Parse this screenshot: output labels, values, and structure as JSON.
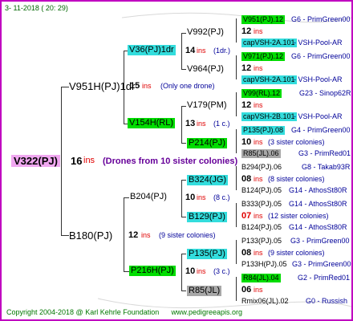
{
  "header": {
    "date": "3- 11-2018 ( 20: 29)"
  },
  "root": {
    "name": "V322(PJ)",
    "ins_count": "16",
    "ins_label": "ins",
    "note": "(Drones from 10 sister colonies)"
  },
  "gen1": [
    {
      "name": "V951H(PJ)1dr",
      "ins_count": "15",
      "ins_label": "ins",
      "note": "(Only one drone)"
    },
    {
      "name": "B180(PJ)",
      "ins_count": "12",
      "ins_label": "ins",
      "note": "(9 sister colonies)"
    }
  ],
  "gen2": [
    {
      "name": "V36(PJ)1dr",
      "ins_count": "14",
      "ins_label": "ins",
      "note": "(1dr.)"
    },
    {
      "name": "V154H(RL)",
      "ins_count": "13",
      "ins_label": "ins",
      "note": "(1 c.)"
    },
    {
      "name": "B204(PJ)",
      "ins_count": "10",
      "ins_label": "ins",
      "note": "(8 c.)"
    },
    {
      "name": "P216H(PJ)",
      "ins_count": "10",
      "ins_label": "ins",
      "note": "(3 c.)"
    }
  ],
  "gen3": [
    {
      "name": "V992(PJ)"
    },
    {
      "name": "V964(PJ)"
    },
    {
      "name": "V179(PM)"
    },
    {
      "name": "P214(PJ)"
    },
    {
      "name": "B324(JG)"
    },
    {
      "name": "B129(PJ)"
    },
    {
      "name": "P135(PJ)"
    },
    {
      "name": "R85(JL)"
    }
  ],
  "gen4": [
    {
      "mother": "V951(PJ).12",
      "mother_source": "G6 - PrimGreen00",
      "ins_count": "12",
      "ins_label": "ins",
      "note": "",
      "father": "capVSH-2A.101",
      "father_source": "- VSH-Pool-AR"
    },
    {
      "mother": "V971(PJ).12",
      "mother_source": "G6 - PrimGreen00",
      "ins_count": "12",
      "ins_label": "ins",
      "note": "",
      "father": "capVSH-2A.101",
      "father_source": "- VSH-Pool-AR"
    },
    {
      "mother": "V99(RL).12",
      "mother_source": "G23 - Sinop62R",
      "ins_count": "12",
      "ins_label": "ins",
      "note": "",
      "father": "capVSH-2B.101",
      "father_source": "- VSH-Pool-AR"
    },
    {
      "mother": "P135(PJ).08",
      "mother_source": "G4 - PrimGreen00",
      "ins_count": "10",
      "ins_label": "ins",
      "note": "(3 sister colonies)",
      "father": "R85(JL).06",
      "father_source": "G3 - PrimRed01"
    },
    {
      "mother": "B294(PJ).06",
      "mother_source": "G8 - Takab93R",
      "ins_count": "08",
      "ins_label": "ins",
      "note": "(8 sister colonies)",
      "father": "B124(PJ).05",
      "father_source": "G14 - AthosSt80R"
    },
    {
      "mother": "B333(PJ).05",
      "mother_source": "G14 - AthosSt80R",
      "ins_count": "07",
      "ins_label": "ins",
      "note": "(12 sister colonies)",
      "father": "B124(PJ).05",
      "father_source": "G14 - AthosSt80R"
    },
    {
      "mother": "P133(PJ).05",
      "mother_source": "G3 - PrimGreen00",
      "ins_count": "08",
      "ins_label": "ins",
      "note": "(9 sister colonies)",
      "father": "P133H(PJ).05",
      "father_source": "G3 - PrimGreen00"
    },
    {
      "mother": "R84(JL).04",
      "mother_source": "G2 - PrimRed01",
      "ins_count": "06",
      "ins_label": "ins",
      "note": "",
      "father": "Rmix06(JL).02",
      "father_source": "G0 - Russish"
    }
  ],
  "footer": {
    "copyright": "Copyright 2004-2018 @ Karl Kehrle Foundation",
    "site": "www.pedigreeapis.org"
  },
  "colors": {
    "border": "#c000c0",
    "root_box": "#f0a8f0",
    "green_box": "#00dd00",
    "cyan_box": "#33dddd",
    "gray_box": "#a8a8a8",
    "ins_red": "#e00000",
    "note_blue": "#000099"
  }
}
